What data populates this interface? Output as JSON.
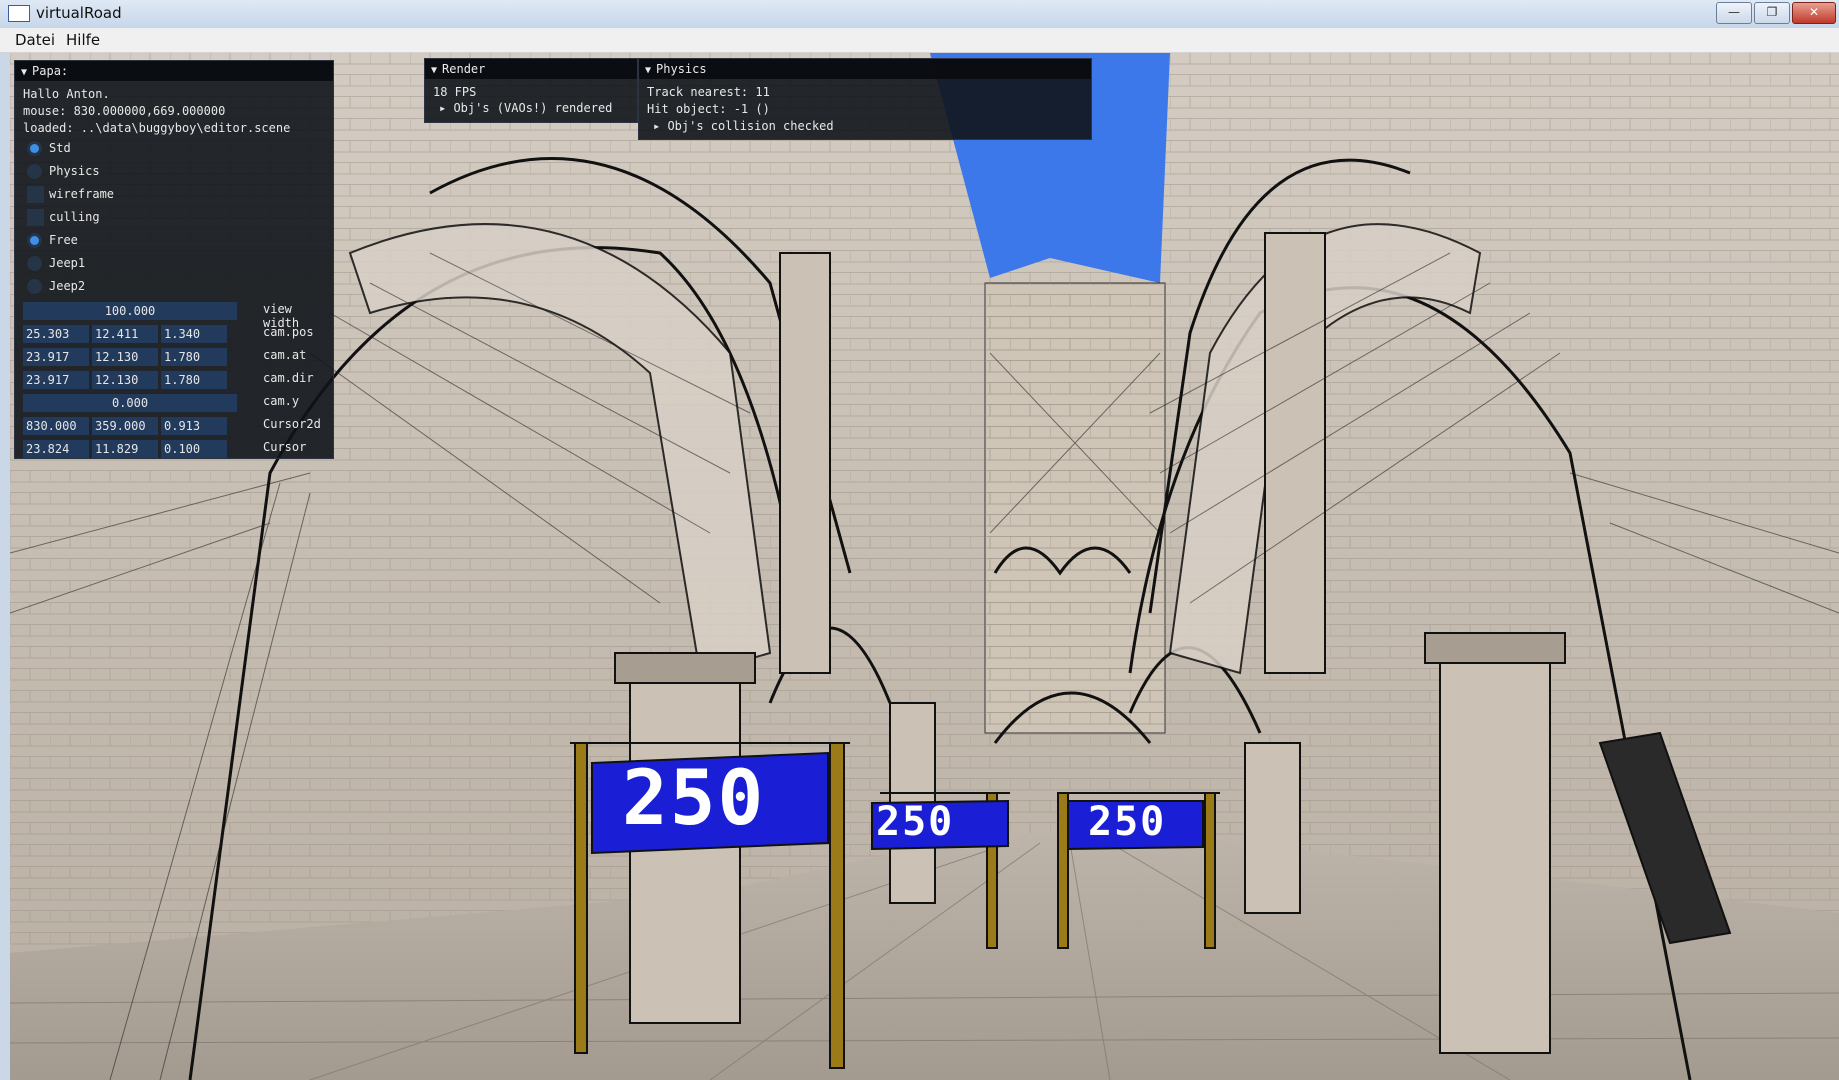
{
  "window": {
    "title": "virtualRoad",
    "minimize_label": "—",
    "restore_label": "❐",
    "close_label": "✕"
  },
  "menu": {
    "items": [
      "Datei",
      "Hilfe"
    ]
  },
  "panels": {
    "papa": {
      "title": "Papa:",
      "greeting": "Hallo Anton.",
      "mouse": "mouse: 830.000000,669.000000",
      "loaded": "loaded: ..\\data\\buggyboy\\editor.scene",
      "options": [
        {
          "label": "Std",
          "kind": "radio",
          "selected": true
        },
        {
          "label": "Physics",
          "kind": "radio",
          "selected": false
        },
        {
          "label": "wireframe",
          "kind": "checkbox",
          "checked": false
        },
        {
          "label": "culling",
          "kind": "checkbox",
          "checked": false
        },
        {
          "label": "Free",
          "kind": "radio",
          "selected": true
        },
        {
          "label": "Jeep1",
          "kind": "radio",
          "selected": false
        },
        {
          "label": "Jeep2",
          "kind": "radio",
          "selected": false
        }
      ],
      "view_width": {
        "label": "view width",
        "value": "100.000"
      },
      "cam_pos": {
        "label": "cam.pos",
        "values": [
          "25.303",
          "12.411",
          "1.340"
        ]
      },
      "cam_at": {
        "label": "cam.at",
        "values": [
          "23.917",
          "12.130",
          "1.780"
        ]
      },
      "cam_dir": {
        "label": "cam.dir",
        "values": [
          "23.917",
          "12.130",
          "1.780"
        ]
      },
      "cam_y": {
        "label": "cam.y",
        "value": "0.000"
      },
      "cursor2d": {
        "label": "Cursor2d",
        "values": [
          "830.000",
          "359.000",
          "0.913"
        ]
      },
      "cursor": {
        "label": "Cursor",
        "values": [
          "23.824",
          "11.829",
          "0.100"
        ]
      }
    },
    "render": {
      "title": "Render",
      "fps": "18 FPS",
      "tree": "Obj's (VAOs!) rendered"
    },
    "physics": {
      "title": "Physics",
      "track": "Track nearest: 11",
      "hit": "Hit object: -1 ()",
      "tree": "Obj's collision checked"
    }
  },
  "banners": [
    "250",
    "250",
    "250"
  ],
  "colors": {
    "sky": "#3c78ea",
    "banner": "#1a1fd6",
    "panel": "#10141a",
    "field": "#223a5c",
    "accent": "#3e8fe8"
  }
}
